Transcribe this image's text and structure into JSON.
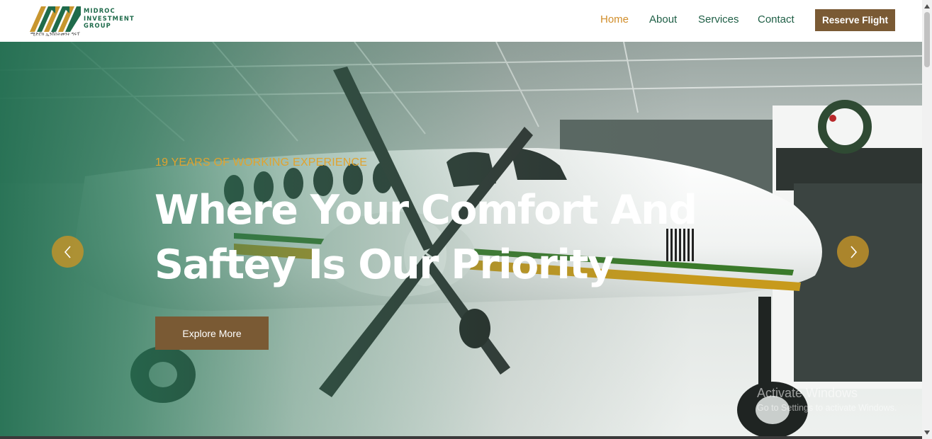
{
  "brand": {
    "name_lines": [
      "MIDROC",
      "INVESTMENT",
      "GROUP"
    ],
    "tagline_amharic": "ሚድሮክ ኢንቨስትመንት ግሩፕ",
    "colors": {
      "green": "#1f6b4b",
      "gold": "#c8962f",
      "brown": "#7a5a34"
    }
  },
  "nav": {
    "items": [
      {
        "label": "Home",
        "active": true
      },
      {
        "label": "About",
        "active": false
      },
      {
        "label": "Services",
        "active": false
      },
      {
        "label": "Contact",
        "active": false
      }
    ],
    "reserve_label": "Reserve Flight"
  },
  "hero": {
    "eyebrow": "19 YEARS OF WORKING EXPERIENCE",
    "headline_line1": "Where Your Comfort And",
    "headline_line2": "Saftey Is Our Priority",
    "cta_label": "Explore More",
    "prev_icon": "chevron-left-icon",
    "next_icon": "chevron-right-icon",
    "overlay_color": "#216e50",
    "accent_color": "#e0a32f"
  },
  "watermark": {
    "title": "Activate Windows",
    "subtitle": "Go to Settings to activate Windows."
  }
}
